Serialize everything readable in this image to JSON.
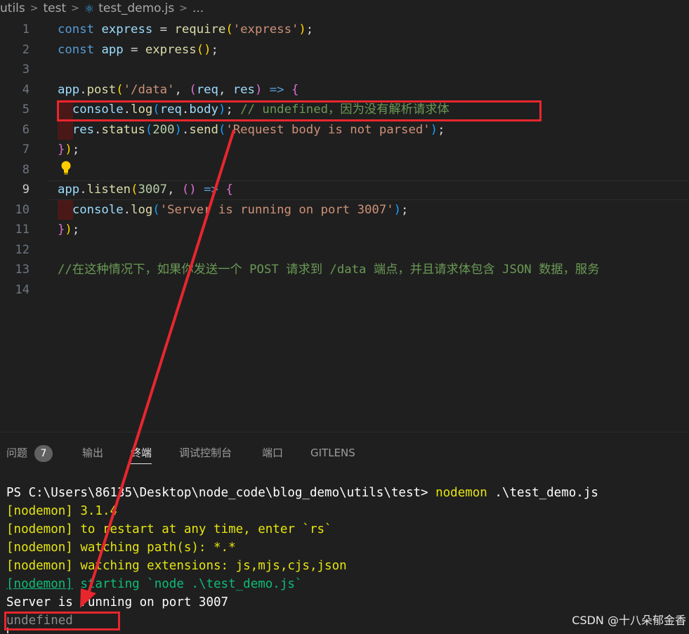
{
  "breadcrumb": {
    "items": [
      "utils",
      "test",
      "test_demo.js",
      "..."
    ]
  },
  "editor": {
    "lines": [
      {
        "num": "1",
        "tokens": [
          [
            "kw",
            "const"
          ],
          [
            "op",
            " "
          ],
          [
            "var",
            "express"
          ],
          [
            "op",
            " = "
          ],
          [
            "fn",
            "require"
          ],
          [
            "p1",
            "("
          ],
          [
            "str",
            "'express'"
          ],
          [
            "p1",
            ")"
          ],
          [
            "op",
            ";"
          ]
        ]
      },
      {
        "num": "2",
        "tokens": [
          [
            "kw",
            "const"
          ],
          [
            "op",
            " "
          ],
          [
            "var",
            "app"
          ],
          [
            "op",
            " = "
          ],
          [
            "fn",
            "express"
          ],
          [
            "p1",
            "()"
          ],
          [
            "op",
            ";"
          ]
        ]
      },
      {
        "num": "3",
        "tokens": []
      },
      {
        "num": "4",
        "tokens": [
          [
            "var",
            "app"
          ],
          [
            "op",
            "."
          ],
          [
            "fn",
            "post"
          ],
          [
            "p1",
            "("
          ],
          [
            "str",
            "'/data'"
          ],
          [
            "op",
            ", "
          ],
          [
            "p2",
            "("
          ],
          [
            "var",
            "req"
          ],
          [
            "op",
            ", "
          ],
          [
            "var",
            "res"
          ],
          [
            "p2",
            ")"
          ],
          [
            "op",
            " "
          ],
          [
            "kw",
            "=>"
          ],
          [
            "op",
            " "
          ],
          [
            "p2",
            "{"
          ]
        ]
      },
      {
        "num": "5",
        "tokens": [
          [
            "op",
            "  "
          ],
          [
            "var",
            "console"
          ],
          [
            "op",
            "."
          ],
          [
            "fn",
            "log"
          ],
          [
            "p3",
            "("
          ],
          [
            "var",
            "req"
          ],
          [
            "op",
            "."
          ],
          [
            "var",
            "body"
          ],
          [
            "p3",
            ")"
          ],
          [
            "op",
            "; "
          ],
          [
            "cm",
            "// undefined，因为没有解析请求体"
          ]
        ]
      },
      {
        "num": "6",
        "tokens": [
          [
            "op",
            "  "
          ],
          [
            "var",
            "res"
          ],
          [
            "op",
            "."
          ],
          [
            "fn",
            "status"
          ],
          [
            "p3",
            "("
          ],
          [
            "num",
            "200"
          ],
          [
            "p3",
            ")"
          ],
          [
            "op",
            "."
          ],
          [
            "fn",
            "send"
          ],
          [
            "p3",
            "("
          ],
          [
            "str",
            "'Request body is not parsed'"
          ],
          [
            "p3",
            ")"
          ],
          [
            "op",
            ";"
          ]
        ]
      },
      {
        "num": "7",
        "tokens": [
          [
            "p2",
            "}"
          ],
          [
            "p1",
            ")"
          ],
          [
            "op",
            ";"
          ]
        ]
      },
      {
        "num": "8",
        "tokens": []
      },
      {
        "num": "9",
        "tokens": [
          [
            "var",
            "app"
          ],
          [
            "op",
            "."
          ],
          [
            "fn",
            "listen"
          ],
          [
            "p1",
            "("
          ],
          [
            "num",
            "3007"
          ],
          [
            "op",
            ", "
          ],
          [
            "p2",
            "()"
          ],
          [
            "op",
            " "
          ],
          [
            "kw",
            "=>"
          ],
          [
            "op",
            " "
          ],
          [
            "p2",
            "{"
          ]
        ]
      },
      {
        "num": "10",
        "tokens": [
          [
            "op",
            "  "
          ],
          [
            "var",
            "console"
          ],
          [
            "op",
            "."
          ],
          [
            "fn",
            "log"
          ],
          [
            "p3",
            "("
          ],
          [
            "str",
            "'Server is running on port 3007'"
          ],
          [
            "p3",
            ")"
          ],
          [
            "op",
            ";"
          ]
        ]
      },
      {
        "num": "11",
        "tokens": [
          [
            "p2",
            "}"
          ],
          [
            "p1",
            ")"
          ],
          [
            "op",
            ";"
          ]
        ]
      },
      {
        "num": "12",
        "tokens": []
      },
      {
        "num": "13",
        "tokens": [
          [
            "cm",
            "//在这种情况下，如果你发送一个 POST 请求到 /data 端点，并且请求体包含 JSON 数据，服务"
          ]
        ]
      },
      {
        "num": "14",
        "tokens": []
      }
    ]
  },
  "panel": {
    "tabs": [
      {
        "label": "问题",
        "badge": "7"
      },
      {
        "label": "输出"
      },
      {
        "label": "终端"
      },
      {
        "label": "调试控制台"
      },
      {
        "label": "端口"
      },
      {
        "label": "GITLENS"
      }
    ]
  },
  "terminal": {
    "lines": [
      [
        [
          "white",
          "PS C:\\Users\\86135\\Desktop\\node_code\\blog_demo\\utils\\test> "
        ],
        [
          "yellow",
          "nodemon"
        ],
        [
          "white",
          " .\\test_demo.js"
        ]
      ],
      [
        [
          "yellow",
          "[nodemon] 3.1.4"
        ]
      ],
      [
        [
          "yellow",
          "[nodemon] to restart at any time, enter `rs`"
        ]
      ],
      [
        [
          "yellow",
          "[nodemon] watching path(s): *.*"
        ]
      ],
      [
        [
          "yellow",
          "[nodemon] watching extensions: js,mjs,cjs,json"
        ]
      ],
      [
        [
          "green under",
          "[nodemon]"
        ],
        [
          "green",
          " starting `node .\\test_demo.js`"
        ]
      ],
      [
        [
          "white",
          "Server is running on port 3007"
        ]
      ],
      [
        [
          "dim",
          "undefined"
        ]
      ]
    ]
  },
  "watermark": "CSDN @十八朵郁金香",
  "colors": {
    "annotation": "#e8262e",
    "background": "#1f1f1f"
  }
}
